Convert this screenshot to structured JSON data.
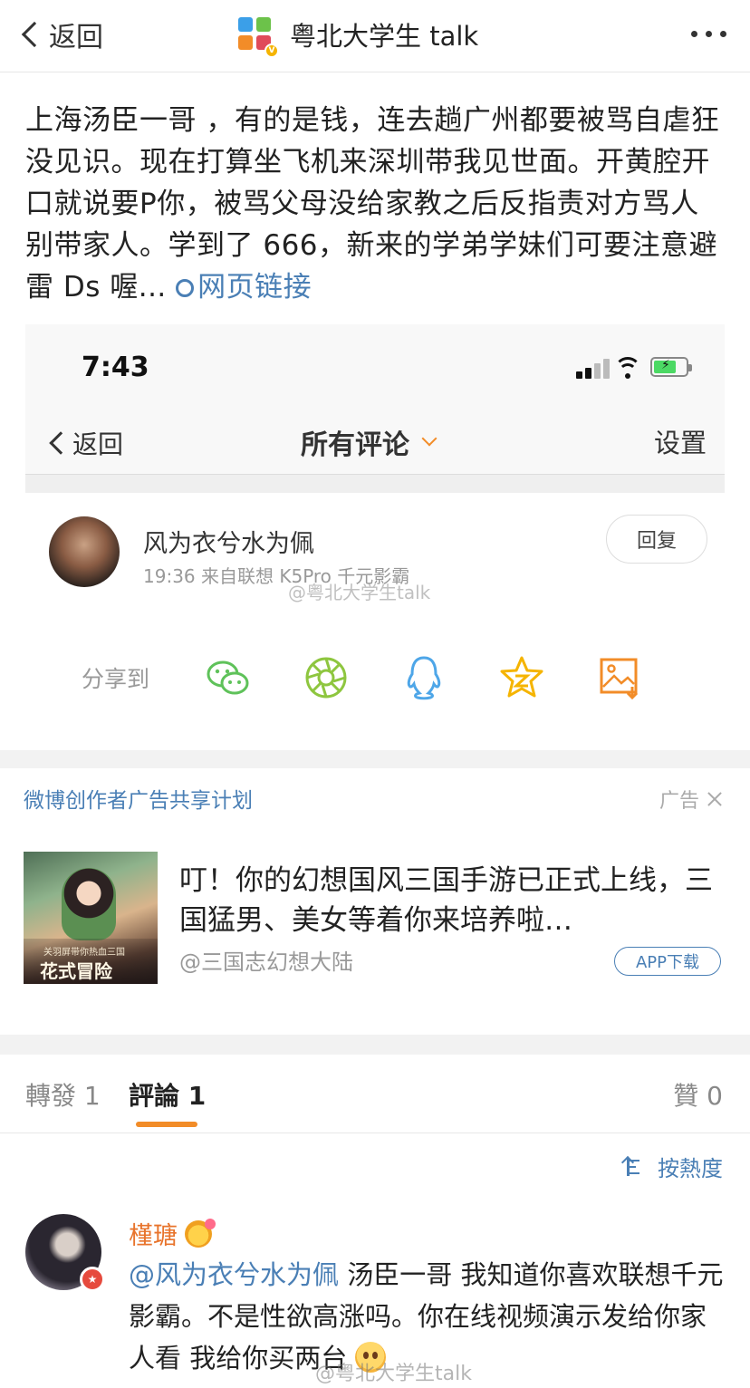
{
  "nav": {
    "back_label": "返回",
    "account_name": "粤北大学生 talk"
  },
  "post": {
    "text": "上海汤臣一哥 ，有的是钱，连去趟广州都要被骂自虐狂没见识。现在打算坐飞机来深圳带我见世面。开黄腔开口就说要P你，被骂父母没给家教之后反指责对方骂人别带家人。学到了 666，新来的学弟学妹们可要注意避雷 Ds 喔...",
    "link_label": "网页链接"
  },
  "screenshot": {
    "status_time": "7:43",
    "back_label": "返回",
    "title": "所有评论",
    "settings_label": "设置",
    "comment": {
      "author": "风为衣兮水为佩",
      "meta": "19:36  来自联想 K5Pro 千元影霸",
      "reply_label": "回复",
      "watermark": "@粤北大学生talk"
    },
    "share": {
      "label": "分享到",
      "icons": [
        "wechat-icon",
        "moments-icon",
        "qq-icon",
        "qzone-icon",
        "save-image-icon"
      ]
    }
  },
  "ad": {
    "header": "微博创作者广告共享计划",
    "tag": "广告",
    "image_small_text": "关羽屏带你热血三国",
    "image_big_text": "花式冒险",
    "title": "叮！你的幻想国风三国手游已正式上线，三国猛男、美女等着你来培养啦…",
    "source": "@三国志幻想大陆",
    "app_button": "APP下载"
  },
  "tabs": {
    "repost": "轉發 1",
    "comment": "評論 1",
    "like": "贊 0"
  },
  "sort_label": "按熱度",
  "comment": {
    "author": "槿瑭",
    "mention": "@风为衣兮水为佩",
    "text": " 汤臣一哥 我知道你喜欢联想千元影霸。不是性欲高涨吗。你在线视频演示发给你家人看 我给你买两台",
    "watermark": "@粤北大学生talk"
  },
  "colors": {
    "link_blue": "#4a7fb5",
    "accent_orange": "#f28c28",
    "wechat_green": "#5fc25a",
    "qq_blue": "#4ea6e8",
    "qzone_yellow": "#f5b400"
  }
}
